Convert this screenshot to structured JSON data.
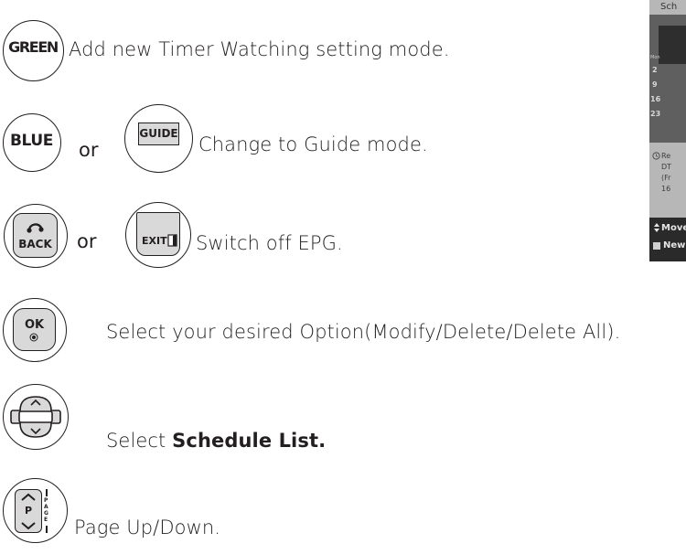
{
  "rows": {
    "green": {
      "key": "GREEN",
      "desc": "Add new Timer Watching setting mode."
    },
    "blue": {
      "key": "BLUE",
      "or": "or",
      "key2": "GUIDE",
      "desc": "Change to Guide mode."
    },
    "back": {
      "key": "BACK",
      "or": "or",
      "key2": "EXIT",
      "desc": "Switch off EPG."
    },
    "ok": {
      "key": "OK",
      "desc": "Select your desired Option(Modify/Delete/Delete All)."
    },
    "nav": {
      "desc_prefix": "Select ",
      "desc_bold": "Schedule List."
    },
    "page": {
      "key": "P",
      "side": "PAGE",
      "desc": "Page Up/Down."
    }
  },
  "thumbnail": {
    "title": "Sch",
    "weekday": "Mon",
    "days": [
      "2",
      "9",
      "16",
      "23"
    ],
    "note_lines": [
      "Re",
      "DT",
      "(Fr",
      "16"
    ],
    "footer": [
      "Move",
      "New"
    ]
  }
}
